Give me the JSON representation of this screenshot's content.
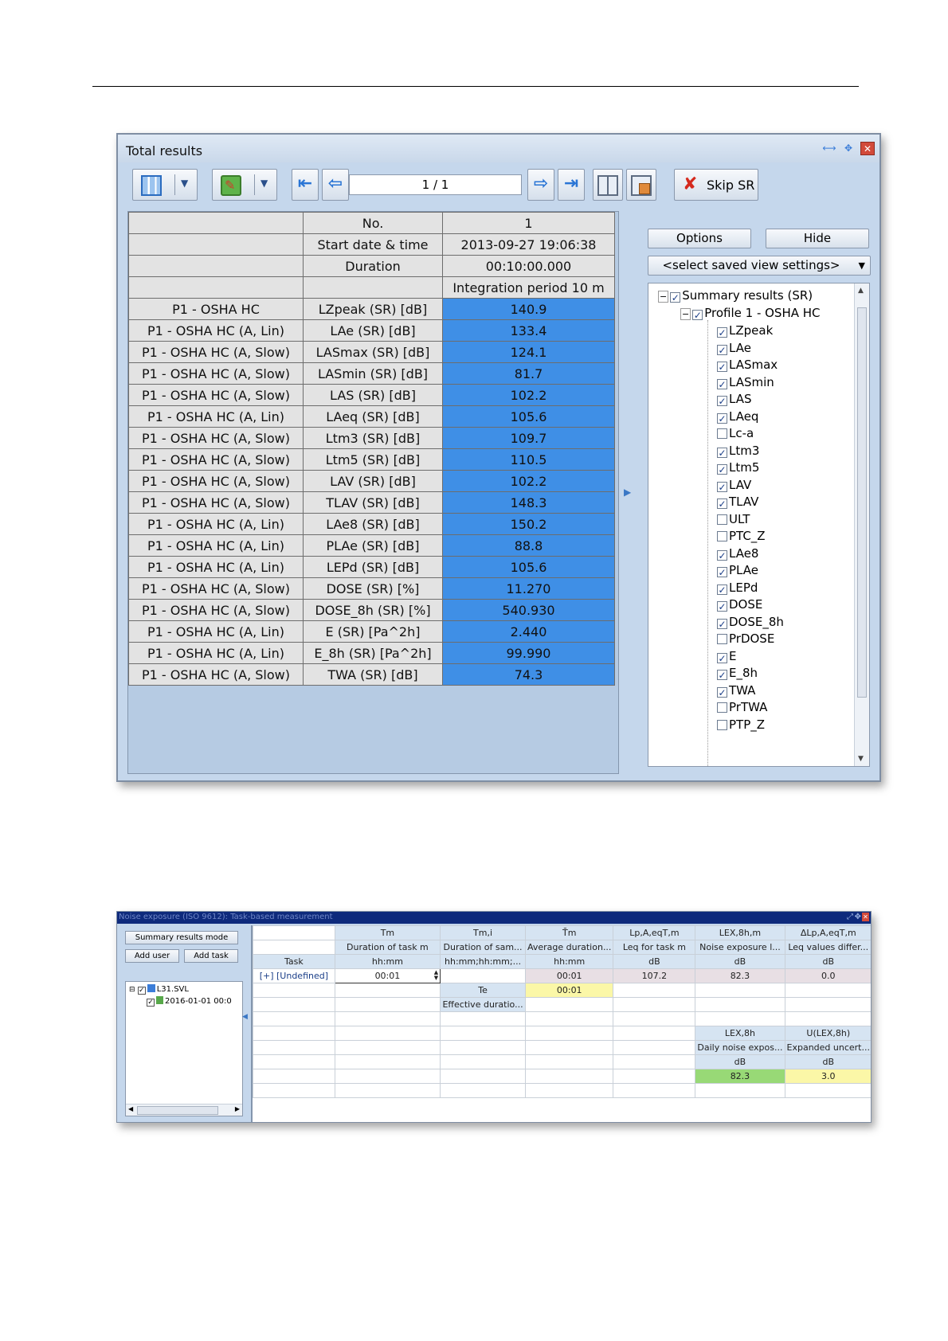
{
  "window1": {
    "title": "Total results",
    "nav_page": "1 / 1",
    "skip_label": "Skip SR",
    "header_rows": [
      {
        "label": "No.",
        "value": "1"
      },
      {
        "label": "Start date & time",
        "value": "2013-09-27 19:06:38"
      },
      {
        "label": "Duration",
        "value": "00:10:00.000"
      },
      {
        "label": "",
        "value": "Integration period 10 m"
      }
    ],
    "rows": [
      {
        "profile": "P1 - OSHA HC",
        "param": "LZpeak (SR) [dB]",
        "value": "140.9"
      },
      {
        "profile": "P1 - OSHA HC (A, Lin)",
        "param": "LAe (SR) [dB]",
        "value": "133.4"
      },
      {
        "profile": "P1 - OSHA HC (A, Slow)",
        "param": "LASmax (SR) [dB]",
        "value": "124.1"
      },
      {
        "profile": "P1 - OSHA HC (A, Slow)",
        "param": "LASmin (SR) [dB]",
        "value": "81.7"
      },
      {
        "profile": "P1 - OSHA HC (A, Slow)",
        "param": "LAS (SR) [dB]",
        "value": "102.2"
      },
      {
        "profile": "P1 - OSHA HC (A, Lin)",
        "param": "LAeq (SR) [dB]",
        "value": "105.6"
      },
      {
        "profile": "P1 - OSHA HC (A, Slow)",
        "param": "Ltm3 (SR) [dB]",
        "value": "109.7"
      },
      {
        "profile": "P1 - OSHA HC (A, Slow)",
        "param": "Ltm5 (SR) [dB]",
        "value": "110.5"
      },
      {
        "profile": "P1 - OSHA HC (A, Slow)",
        "param": "LAV (SR) [dB]",
        "value": "102.2"
      },
      {
        "profile": "P1 - OSHA HC (A, Slow)",
        "param": "TLAV (SR) [dB]",
        "value": "148.3"
      },
      {
        "profile": "P1 - OSHA HC (A, Lin)",
        "param": "LAe8 (SR) [dB]",
        "value": "150.2"
      },
      {
        "profile": "P1 - OSHA HC (A, Lin)",
        "param": "PLAe (SR) [dB]",
        "value": "88.8"
      },
      {
        "profile": "P1 - OSHA HC (A, Lin)",
        "param": "LEPd (SR) [dB]",
        "value": "105.6"
      },
      {
        "profile": "P1 - OSHA HC (A, Slow)",
        "param": "DOSE (SR) [%]",
        "value": "11.270"
      },
      {
        "profile": "P1 - OSHA HC (A, Slow)",
        "param": "DOSE_8h (SR) [%]",
        "value": "540.930"
      },
      {
        "profile": "P1 - OSHA HC (A, Lin)",
        "param": "E (SR) [Pa^2h]",
        "value": "2.440"
      },
      {
        "profile": "P1 - OSHA HC (A, Lin)",
        "param": "E_8h (SR) [Pa^2h]",
        "value": "99.990"
      },
      {
        "profile": "P1 - OSHA HC (A, Slow)",
        "param": "TWA (SR) [dB]",
        "value": "74.3"
      }
    ],
    "options_label": "Options",
    "hide_label": "Hide",
    "view_select": "<select saved view settings>",
    "tree_root": "Summary results (SR)",
    "tree_profile": "Profile 1 - OSHA HC",
    "tree_items": [
      {
        "label": "LZpeak",
        "checked": true
      },
      {
        "label": "LAe",
        "checked": true
      },
      {
        "label": "LASmax",
        "checked": true
      },
      {
        "label": "LASmin",
        "checked": true
      },
      {
        "label": "LAS",
        "checked": true
      },
      {
        "label": "LAeq",
        "checked": true
      },
      {
        "label": "Lc-a",
        "checked": false
      },
      {
        "label": "Ltm3",
        "checked": true
      },
      {
        "label": "Ltm5",
        "checked": true
      },
      {
        "label": "LAV",
        "checked": true
      },
      {
        "label": "TLAV",
        "checked": true
      },
      {
        "label": "ULT",
        "checked": false
      },
      {
        "label": "PTC_Z",
        "checked": false
      },
      {
        "label": "LAe8",
        "checked": true
      },
      {
        "label": "PLAe",
        "checked": true
      },
      {
        "label": "LEPd",
        "checked": true
      },
      {
        "label": "DOSE",
        "checked": true
      },
      {
        "label": "DOSE_8h",
        "checked": true
      },
      {
        "label": "PrDOSE",
        "checked": false
      },
      {
        "label": "E",
        "checked": true
      },
      {
        "label": "E_8h",
        "checked": true
      },
      {
        "label": "TWA",
        "checked": true
      },
      {
        "label": "PrTWA",
        "checked": false
      },
      {
        "label": "PTP_Z",
        "checked": false
      }
    ]
  },
  "window2": {
    "title": "Noise exposure (ISO 9612): Task-based measurement",
    "summary_mode": "Summary results mode",
    "add_user": "Add user",
    "add_task": "Add task",
    "tree_file": "L31.SVL",
    "tree_date": "2016-01-01 00:0",
    "columns": [
      {
        "sym": "Tm",
        "desc": "Duration of task m",
        "unit": "hh:mm"
      },
      {
        "sym": "Tm,i",
        "desc": "Duration of sam...",
        "unit": "hh:mm;hh:mm;..."
      },
      {
        "sym": "T̄m",
        "desc": "Average duration...",
        "unit": "hh:mm"
      },
      {
        "sym": "Lp,A,eqT,m",
        "desc": "Leq for task m",
        "unit": "dB"
      },
      {
        "sym": "LEX,8h,m",
        "desc": "Noise exposure l...",
        "unit": "dB"
      },
      {
        "sym": "ΔLp,A,eqT,m",
        "desc": "Leq values differ...",
        "unit": "dB"
      }
    ],
    "task_header": "Task",
    "task_name": "[+] [Undefined]",
    "task_row": {
      "tm": "00:01",
      "avg": "00:01",
      "leq": "107.2",
      "lex": "82.3",
      "delta": "0.0"
    },
    "te": {
      "sym": "Te",
      "value": "00:01",
      "desc": "Effective duratio..."
    },
    "daily": {
      "sym": "LEX,8h",
      "desc": "Daily noise expos...",
      "unit": "dB",
      "value": "82.3"
    },
    "uncert": {
      "sym": "U(LEX,8h)",
      "desc": "Expanded uncert...",
      "unit": "dB",
      "value": "3.0"
    }
  }
}
